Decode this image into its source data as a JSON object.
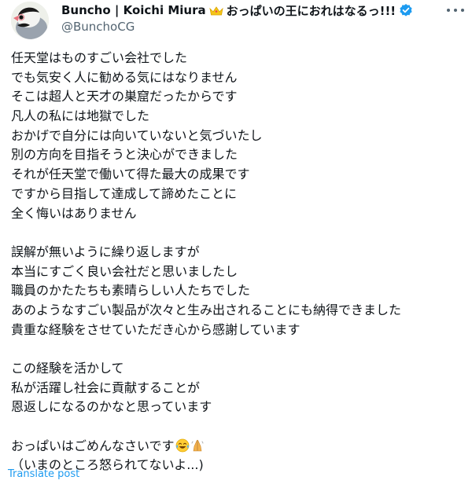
{
  "author": {
    "display_name": "Buncho | Koichi Miura",
    "name_suffix": "おっぱいの王におれはなるっ!!!",
    "handle": "@BunchoCG",
    "crown_icon": "crown-icon",
    "verified_icon": "verified-badge-icon",
    "verified_color": "#1d9bf0"
  },
  "tweet": {
    "paragraph1": [
      "任天堂はものすごい会社でした",
      "でも気安く人に勧める気にはなりません",
      "そこは超人と天才の巣窟だったからです",
      "凡人の私には地獄でした",
      "おかげで自分には向いていないと気づいたし",
      "別の方向を目指そうと決心ができました",
      "それが任天堂で働いて得た最大の成果です",
      "ですから目指して達成して諦めたことに",
      "全く悔いはありません"
    ],
    "paragraph2": [
      "誤解が無いように繰り返しますが",
      "本当にすごく良い会社だと思いましたし",
      "職員のかたたちも素晴らしい人たちでした",
      "あのようなすごい製品が次々と生み出されることにも納得できました",
      "貴重な経験をさせていただき心から感謝しています"
    ],
    "paragraph3": [
      "この経験を活かして",
      "私が活躍し社会に貢献することが",
      "恩返しになるのかなと思っています"
    ],
    "paragraph4": [
      "おっぱいはごめんなさいです",
      "（いまのところ怒られてないよ...)"
    ],
    "emojis": [
      "face-with-tears-of-joy-emoji",
      "folded-hands-emoji"
    ]
  },
  "actions": {
    "translate_label": "Translate post",
    "more_icon": "more-options-icon"
  },
  "colors": {
    "text": "#0f1419",
    "secondary": "#536471",
    "link": "#1d9bf0"
  }
}
